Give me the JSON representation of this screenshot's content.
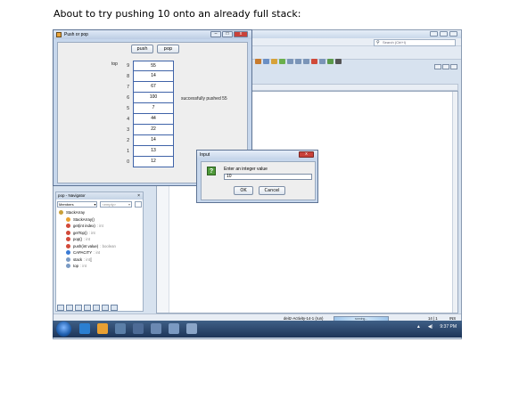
{
  "heading": "About to try pushing 10 onto an already full stack:",
  "ide": {
    "search_placeholder": "Search (Ctrl+I)",
    "status_project": "deitz-Activity-14-1 (run)",
    "status_progress": "running...",
    "status_insert": "INS",
    "status_position": "14 | 1"
  },
  "push_pop_window": {
    "title": "Push or pop",
    "push_label": "push",
    "pop_label": "pop",
    "top_label": "top",
    "indices": [
      "9",
      "8",
      "7",
      "6",
      "5",
      "4",
      "3",
      "2",
      "1",
      "0"
    ],
    "stack_values": [
      "55",
      "14",
      "67",
      "100",
      "7",
      "44",
      "22",
      "14",
      "13",
      "12"
    ],
    "message": "successfully pushed 55"
  },
  "dialog": {
    "title": "Input",
    "prompt": "Enter an integer value",
    "input_value": "10",
    "ok_label": "OK",
    "cancel_label": "Cancel",
    "close_label": "x"
  },
  "navigator": {
    "title": "pop - Navigator",
    "close": "×",
    "combo_members": "Members",
    "combo_empty": "<empty>",
    "items": [
      {
        "label": "StackArray",
        "type": "",
        "color": "#c9a03a"
      },
      {
        "label": "StackArray()",
        "type": "",
        "color": "#e8a030"
      },
      {
        "label": "get(int index)",
        "type": ": int",
        "color": "#d24a3a"
      },
      {
        "label": "getTop()",
        "type": ": int",
        "color": "#d24a3a"
      },
      {
        "label": "pop()",
        "type": ": int",
        "color": "#d24a3a"
      },
      {
        "label": "push(int value)",
        "type": ": boolean",
        "color": "#d24a3a"
      },
      {
        "label": "CAPACITY",
        "type": ": int",
        "color": "#3a7bd5"
      },
      {
        "label": "stack",
        "type": ": int[]",
        "color": "#7a9ac4"
      },
      {
        "label": "top",
        "type": ": int",
        "color": "#7a9ac4"
      }
    ]
  },
  "taskbar": {
    "time": "9:37 PM"
  }
}
